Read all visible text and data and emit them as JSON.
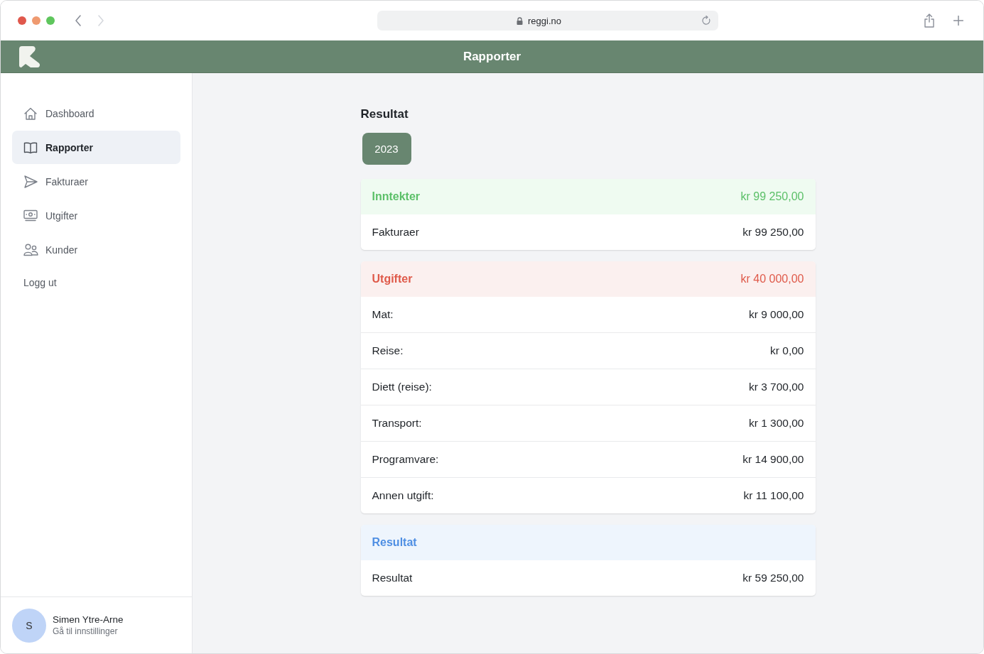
{
  "browser": {
    "url": "reggi.no"
  },
  "header": {
    "title": "Rapporter"
  },
  "sidebar": {
    "items": [
      {
        "label": "Dashboard",
        "selected": false
      },
      {
        "label": "Rapporter",
        "selected": true
      },
      {
        "label": "Fakturaer",
        "selected": false
      },
      {
        "label": "Utgifter",
        "selected": false
      },
      {
        "label": "Kunder",
        "selected": false
      }
    ],
    "logout": "Logg ut",
    "user": {
      "initial": "S",
      "name": "Simen Ytre-Arne",
      "subtitle": "Gå til innstillinger"
    }
  },
  "main": {
    "title": "Resultat",
    "years": [
      {
        "label": "2023",
        "selected": true
      }
    ],
    "sections": [
      {
        "kind": "income",
        "title": "Inntekter",
        "total": "kr 99 250,00",
        "rows": [
          {
            "label": "Fakturaer",
            "amount": "kr 99 250,00"
          }
        ]
      },
      {
        "kind": "expense",
        "title": "Utgifter",
        "total": "kr 40 000,00",
        "rows": [
          {
            "label": "Mat:",
            "amount": "kr 9 000,00"
          },
          {
            "label": "Reise:",
            "amount": "kr 0,00"
          },
          {
            "label": "Diett (reise):",
            "amount": "kr 3 700,00"
          },
          {
            "label": "Transport:",
            "amount": "kr 1 300,00"
          },
          {
            "label": "Programvare:",
            "amount": "kr 14 900,00"
          },
          {
            "label": "Annen utgift:",
            "amount": "kr 11 100,00"
          }
        ]
      },
      {
        "kind": "result",
        "title": "Resultat",
        "rows": [
          {
            "label": "Resultat",
            "amount": "kr 59 250,00"
          }
        ]
      }
    ]
  }
}
